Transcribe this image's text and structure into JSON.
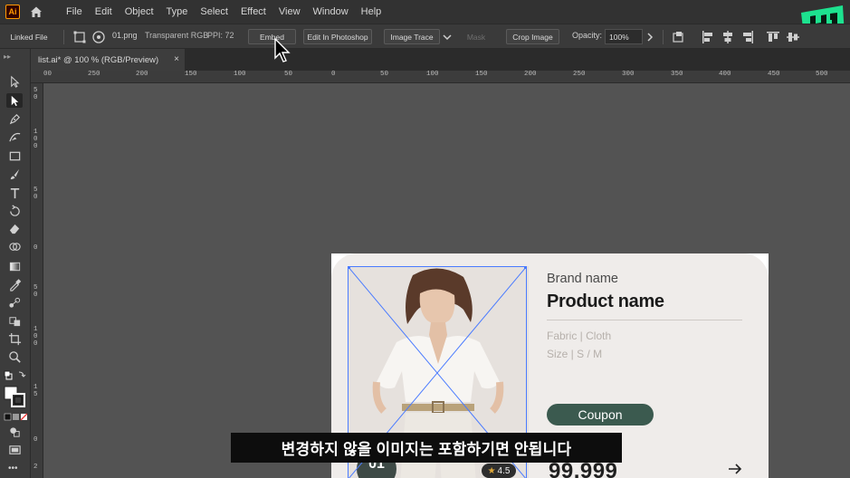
{
  "app": {
    "logo_text": "Ai"
  },
  "menu": [
    "File",
    "Edit",
    "Object",
    "Type",
    "Select",
    "Effect",
    "View",
    "Window",
    "Help"
  ],
  "control_bar": {
    "linked_file": "Linked File",
    "filename": "01.png",
    "color_mode": "Transparent RGB",
    "ppi": "PPI: 72",
    "embed": "Embed",
    "edit_photoshop": "Edit In Photoshop",
    "image_trace": "Image Trace",
    "mask": "Mask",
    "crop_image": "Crop Image",
    "opacity_label": "Opacity:",
    "opacity_value": "100%"
  },
  "document_tab": {
    "title": "list.ai* @ 100 % (RGB/Preview)",
    "close": "×"
  },
  "ruler_h_ticks": [
    "00",
    "250",
    "200",
    "150",
    "100",
    "50",
    "0",
    "50",
    "100",
    "150",
    "200",
    "250",
    "300",
    "350",
    "400",
    "450",
    "500"
  ],
  "ruler_v_ticks": [
    "5",
    "0",
    "1",
    "0",
    "0",
    "5",
    "0",
    "0",
    "5",
    "0",
    "1",
    "0",
    "0",
    "1",
    "5",
    "0",
    "2"
  ],
  "card": {
    "brand_name": "Brand name",
    "product_name": "Product name",
    "fabric": "Fabric  |  Cloth",
    "size": "Size  |  S / M",
    "coupon": "Coupon",
    "price": "99,999",
    "rating": "4.5",
    "badge": "01"
  },
  "subtitle": "변경하지 않을 이미지는 포함하기면 안됩니다",
  "colors": {
    "menubar": "#323232",
    "canvas": "#535353",
    "coupon": "#3b5a4f",
    "selection": "#4a7bff",
    "brand_badge": "#1de28f"
  }
}
